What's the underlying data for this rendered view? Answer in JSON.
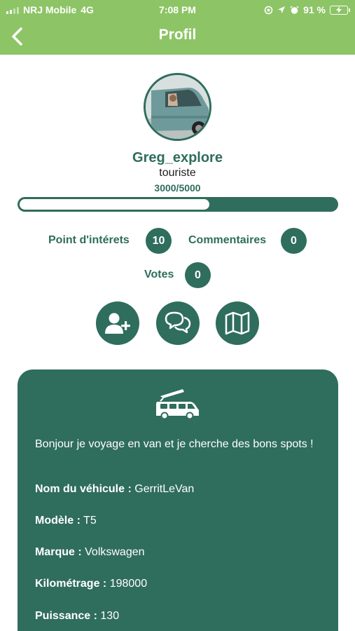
{
  "status_bar": {
    "carrier": "NRJ Mobile",
    "network": "4G",
    "time": "7:08 PM",
    "battery": "91 %"
  },
  "header": {
    "title": "Profil"
  },
  "profile": {
    "username": "Greg_explore",
    "role": "touriste",
    "xp_text": "3000/5000",
    "xp_progress": 0.6
  },
  "stats": [
    {
      "label": "Point d'intérets",
      "value": "10"
    },
    {
      "label": "Commentaires",
      "value": "0"
    },
    {
      "label": "Votes",
      "value": "0"
    }
  ],
  "actions": [
    {
      "icon": "add-user-icon"
    },
    {
      "icon": "chat-bubbles-icon"
    },
    {
      "icon": "map-icon"
    }
  ],
  "card": {
    "icon": "campervan-icon",
    "bio": "Bonjour je voyage en van et je cherche des bons spots !",
    "vehicle_name_label": "Nom du véhicule :",
    "vehicle_name_value": "GerritLeVan",
    "model_label": "Modèle :",
    "model_value": "T5",
    "brand_label": "Marque :",
    "brand_value": "Volkswagen",
    "mileage_label": "Kilométrage :",
    "mileage_value": "198000",
    "power_label": "Puissance :",
    "power_value": "130"
  },
  "colors": {
    "header": "#8dc466",
    "primary": "#2f6d5c"
  }
}
